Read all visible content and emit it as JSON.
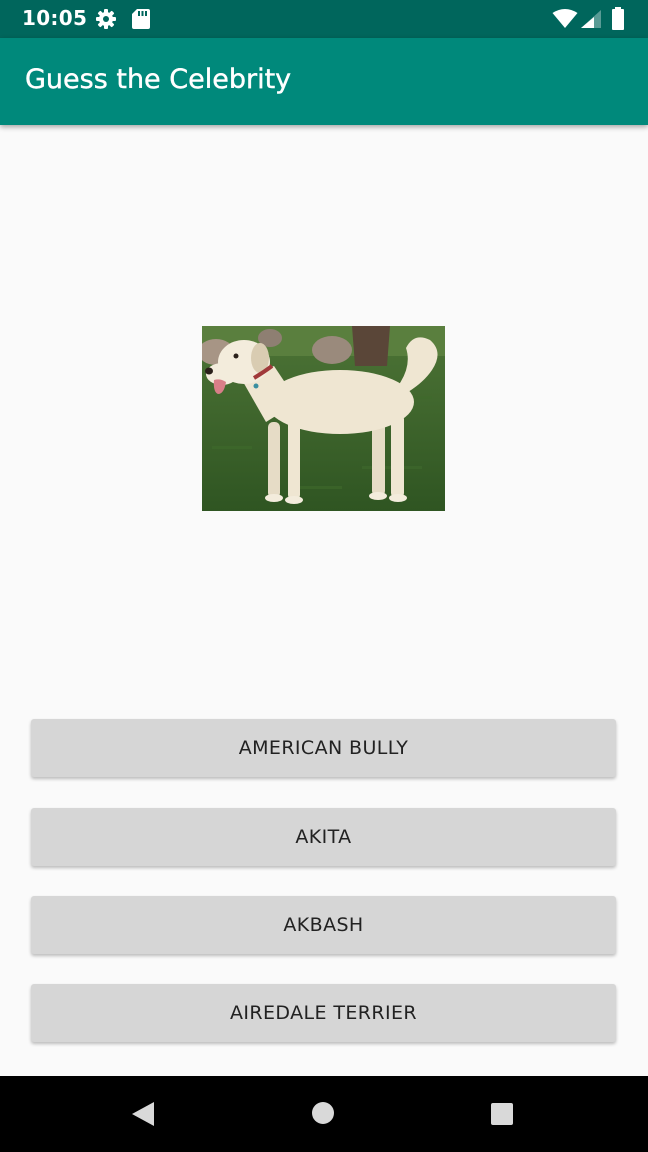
{
  "status_bar": {
    "time": "10:05",
    "icons": [
      "gear-icon",
      "sd-card-icon",
      "wifi-icon",
      "signal-icon",
      "battery-icon"
    ],
    "background": "#00665c"
  },
  "app_bar": {
    "title": "Guess the Celebrity",
    "background": "#00897b"
  },
  "question": {
    "image": "dog-photo"
  },
  "answers": [
    {
      "label": "AMERICAN BULLY"
    },
    {
      "label": "AKITA"
    },
    {
      "label": "AKBASH"
    },
    {
      "label": "AIREDALE TERRIER"
    }
  ],
  "nav_bar": {
    "icons": [
      "back-icon",
      "home-icon",
      "recents-icon"
    ]
  }
}
